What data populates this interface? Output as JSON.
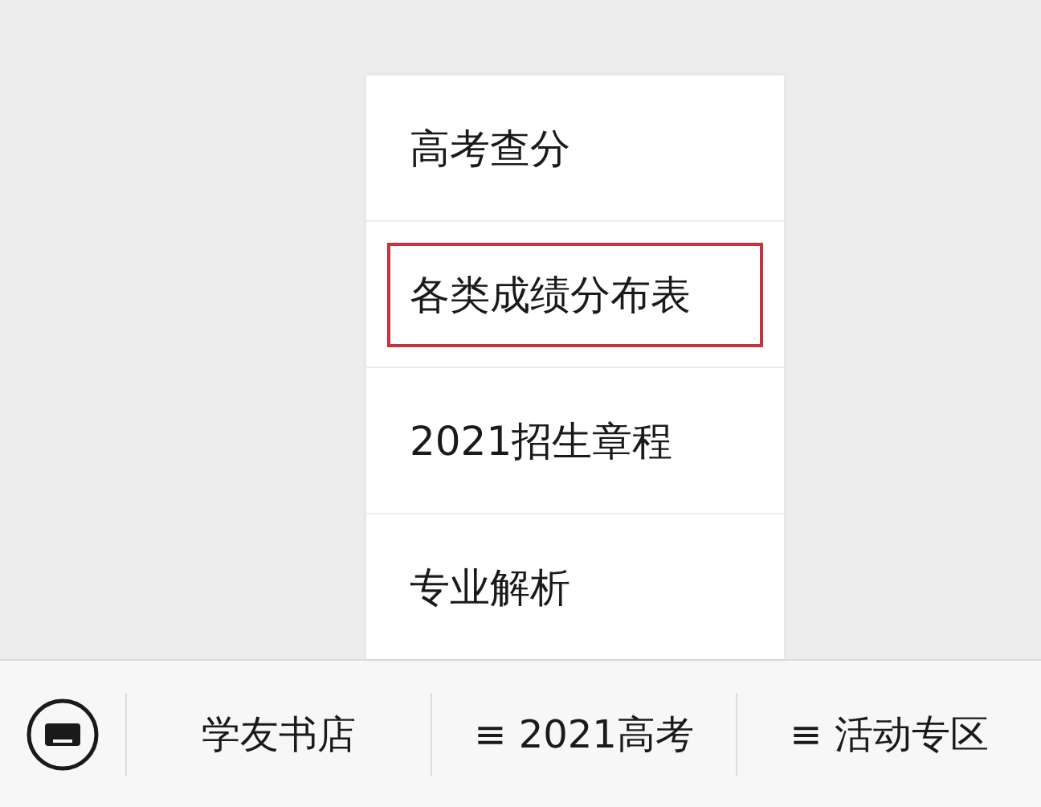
{
  "popup_menu": {
    "items": [
      {
        "label": "高考查分",
        "highlighted": false
      },
      {
        "label": "各类成绩分布表",
        "highlighted": true
      },
      {
        "label": "2021招生章程",
        "highlighted": false
      },
      {
        "label": "专业解析",
        "highlighted": false
      }
    ]
  },
  "bottom_menu": {
    "items": [
      {
        "label": "学友书店"
      },
      {
        "label": "≡ 2021高考"
      },
      {
        "label": "≡ 活动专区"
      }
    ]
  }
}
